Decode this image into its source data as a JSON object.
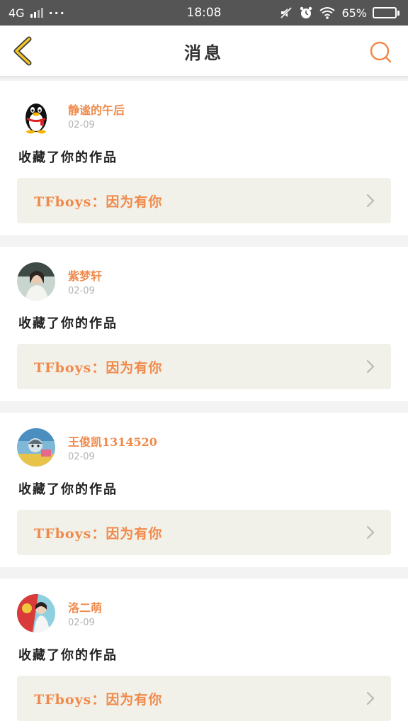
{
  "status_bar": {
    "network": "4G",
    "more": "···",
    "time": "18:08",
    "battery": "65%",
    "battery_level": 0.65
  },
  "header": {
    "title": "消息",
    "back_icon": "chevron-left-icon",
    "search_icon": "search-icon"
  },
  "colors": {
    "accent": "#f08a4b",
    "back_icon": "#f3c623",
    "link_bg": "#f2f1e9",
    "date": "#b3b3b3",
    "chevron": "#b9b9b9"
  },
  "messages": [
    {
      "username": "静谧的午后",
      "date": "02-09",
      "action": "收藏了你的作品",
      "work_title": "TFboys：因为有你",
      "avatar": "qq-penguin-avatar"
    },
    {
      "username": "紫梦轩",
      "date": "02-09",
      "action": "收藏了你的作品",
      "work_title": "TFboys：因为有你",
      "avatar": "photo-avatar"
    },
    {
      "username": "王俊凯1314520",
      "date": "02-09",
      "action": "收藏了你的作品",
      "work_title": "TFboys：因为有你",
      "avatar": "photo-avatar"
    },
    {
      "username": "洛二萌",
      "date": "02-09",
      "action": "收藏了你的作品",
      "work_title": "TFboys：因为有你",
      "avatar": "photo-avatar"
    }
  ]
}
